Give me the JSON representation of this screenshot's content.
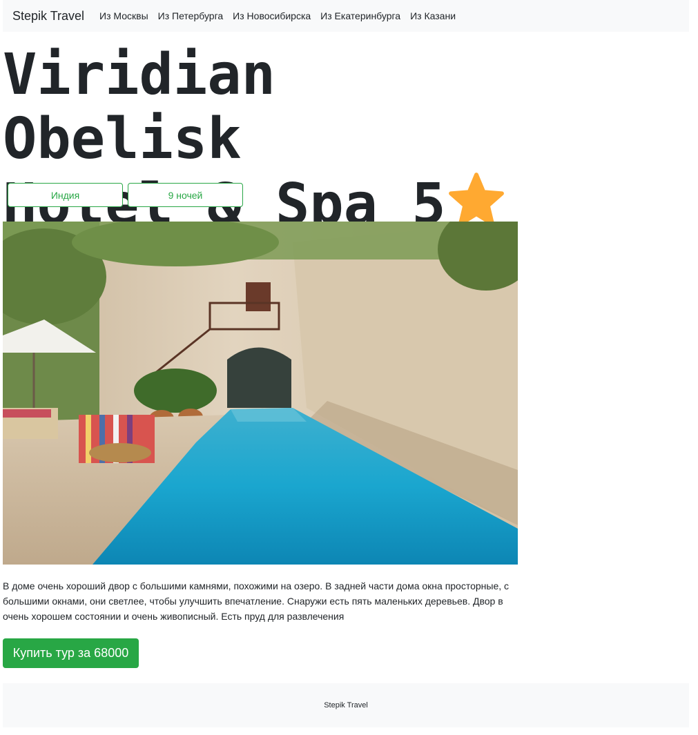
{
  "navbar": {
    "brand": "Stepik Travel",
    "links": [
      "Из Москвы",
      "Из Петербурга",
      "Из Новосибирска",
      "Из Екатеринбурга",
      "Из Казани"
    ]
  },
  "hotel": {
    "title_line1": "Viridian Obelisk",
    "title_line2": "Hotel & Spa 5",
    "star_icon": "star-icon",
    "star_color": "#ffa931",
    "tags": {
      "country": "Индия",
      "nights": "9 ночей"
    },
    "photo": "courtyard-pool-photo",
    "description": "В доме очень хороший двор с большими камнями, похожими на озеро. В задней части дома окна просторные, с большими окнами, они светлее, чтобы улучшить впечатление. Снаружи есть пять маленьких деревьев. Двор в очень хорошем состоянии и очень живописный. Есть пруд для развлечения"
  },
  "buy_button": {
    "label": "Купить тур за 68000",
    "color": "#28a745"
  },
  "footer": {
    "text": "Stepik Travel"
  }
}
